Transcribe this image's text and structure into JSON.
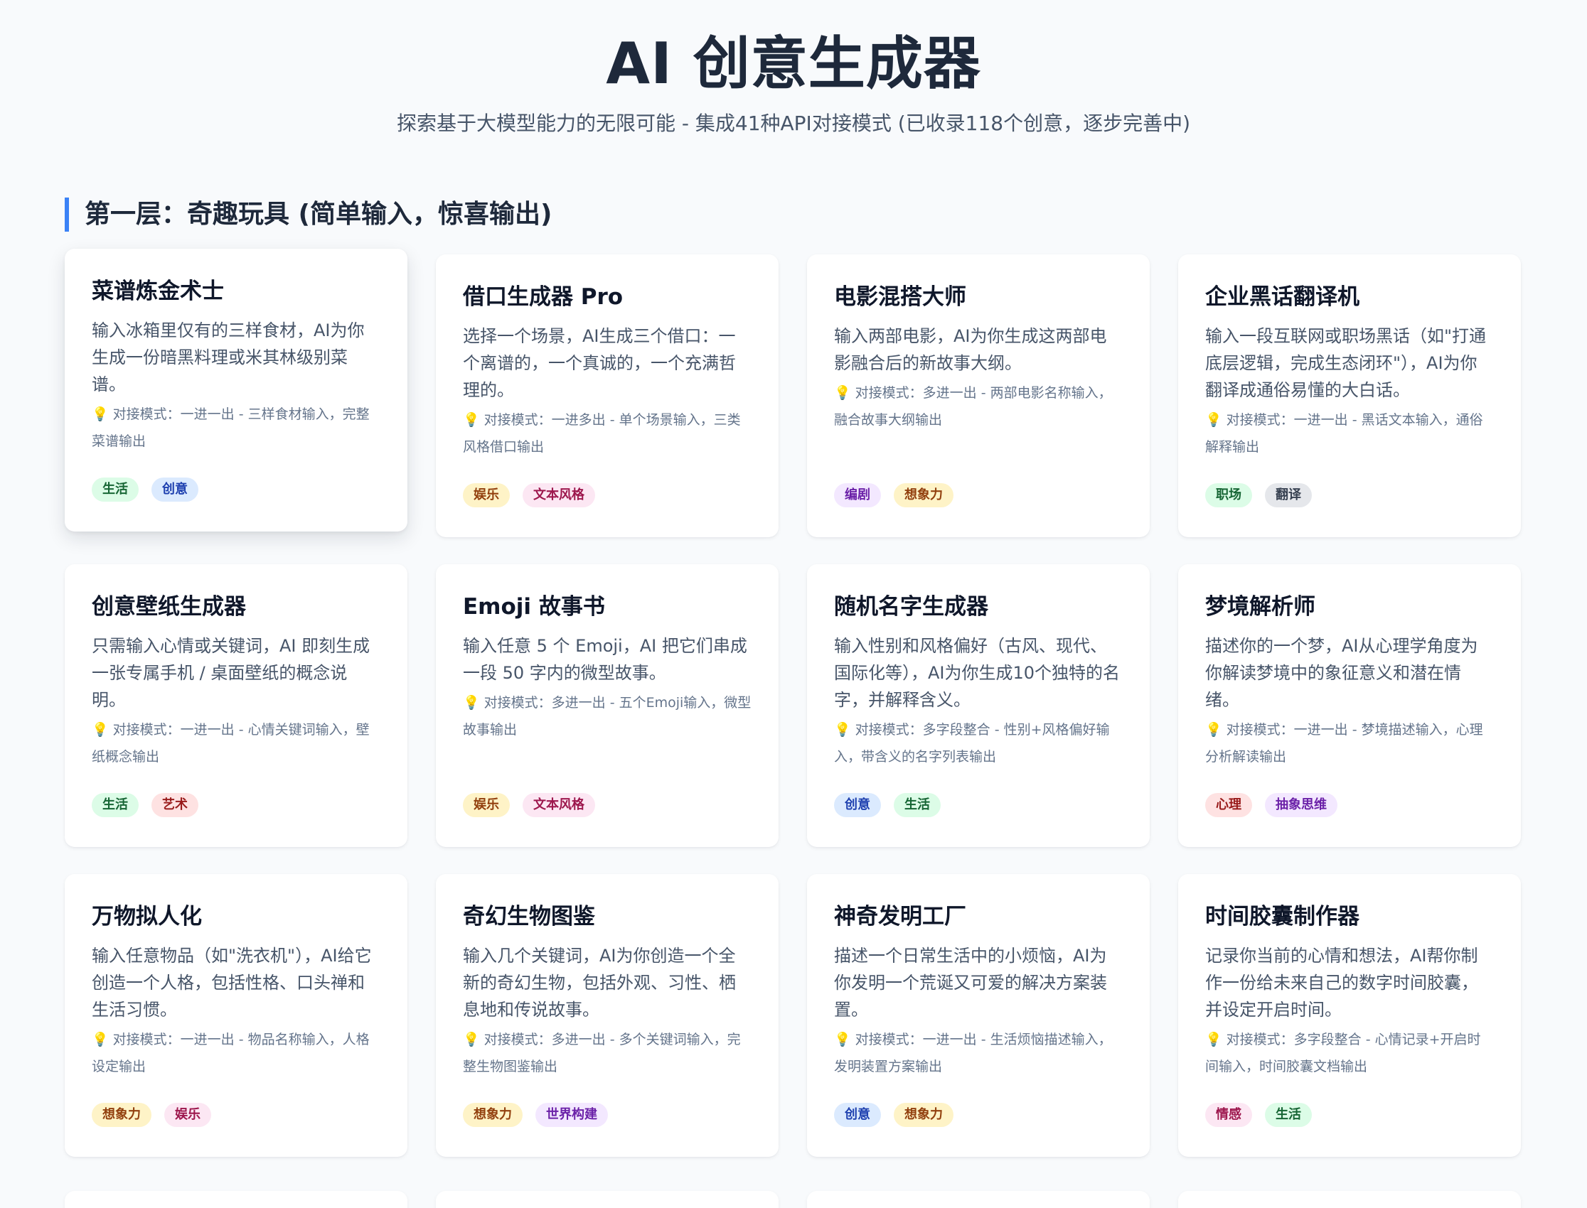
{
  "header": {
    "title": "AI 创意生成器",
    "subtitle": "探索基于大模型能力的无限可能 - 集成41种API对接模式 (已收录118个创意，逐步完善中)"
  },
  "section": {
    "title": "第一层：奇趣玩具 (简单输入，惊喜输出)"
  },
  "colors": {
    "accent": "#3b82f6",
    "green": "#dcfce7",
    "blue": "#dbeafe",
    "amber": "#fef3c7",
    "pink": "#fce7f3",
    "purple": "#f3e8ff",
    "gray": "#e5e7eb",
    "red": "#fee2e2"
  },
  "cards": [
    {
      "title": "菜谱炼金术士",
      "desc": "输入冰箱里仅有的三样食材，AI为你生成一份暗黑料理或米其林级别菜谱。",
      "mode": "对接模式：一进一出 - 三样食材输入，完整菜谱输出",
      "tags": [
        {
          "label": "生活",
          "color": "green"
        },
        {
          "label": "创意",
          "color": "blue"
        }
      ]
    },
    {
      "title": "借口生成器 Pro",
      "desc": "选择一个场景，AI生成三个借口：一个离谱的，一个真诚的，一个充满哲理的。",
      "mode": "对接模式：一进多出 - 单个场景输入，三类风格借口输出",
      "tags": [
        {
          "label": "娱乐",
          "color": "amber"
        },
        {
          "label": "文本风格",
          "color": "pink"
        }
      ]
    },
    {
      "title": "电影混搭大师",
      "desc": "输入两部电影，AI为你生成这两部电影融合后的新故事大纲。",
      "mode": "对接模式：多进一出 - 两部电影名称输入，融合故事大纲输出",
      "tags": [
        {
          "label": "编剧",
          "color": "purple"
        },
        {
          "label": "想象力",
          "color": "amber"
        }
      ]
    },
    {
      "title": "企业黑话翻译机",
      "desc": "输入一段互联网或职场黑话（如\"打通底层逻辑，完成生态闭环\"），AI为你翻译成通俗易懂的大白话。",
      "mode": "对接模式：一进一出 - 黑话文本输入，通俗解释输出",
      "tags": [
        {
          "label": "职场",
          "color": "green"
        },
        {
          "label": "翻译",
          "color": "gray"
        }
      ]
    },
    {
      "title": "创意壁纸生成器",
      "desc": "只需输入心情或关键词，AI 即刻生成一张专属手机 / 桌面壁纸的概念说明。",
      "mode": "对接模式：一进一出 - 心情关键词输入，壁纸概念输出",
      "tags": [
        {
          "label": "生活",
          "color": "green"
        },
        {
          "label": "艺术",
          "color": "red"
        }
      ]
    },
    {
      "title": "Emoji 故事书",
      "desc": "输入任意 5 个 Emoji，AI 把它们串成一段 50 字内的微型故事。",
      "mode": "对接模式：多进一出 - 五个Emoji输入，微型故事输出",
      "tags": [
        {
          "label": "娱乐",
          "color": "amber"
        },
        {
          "label": "文本风格",
          "color": "pink"
        }
      ]
    },
    {
      "title": "随机名字生成器",
      "desc": "输入性别和风格偏好（古风、现代、国际化等），AI为你生成10个独特的名字，并解释含义。",
      "mode": "对接模式：多字段整合 - 性别+风格偏好输入，带含义的名字列表输出",
      "tags": [
        {
          "label": "创意",
          "color": "blue"
        },
        {
          "label": "生活",
          "color": "green"
        }
      ]
    },
    {
      "title": "梦境解析师",
      "desc": "描述你的一个梦，AI从心理学角度为你解读梦境中的象征意义和潜在情绪。",
      "mode": "对接模式：一进一出 - 梦境描述输入，心理分析解读输出",
      "tags": [
        {
          "label": "心理",
          "color": "red"
        },
        {
          "label": "抽象思维",
          "color": "purple"
        }
      ]
    },
    {
      "title": "万物拟人化",
      "desc": "输入任意物品（如\"洗衣机\"），AI给它创造一个人格，包括性格、口头禅和生活习惯。",
      "mode": "对接模式：一进一出 - 物品名称输入，人格设定输出",
      "tags": [
        {
          "label": "想象力",
          "color": "amber"
        },
        {
          "label": "娱乐",
          "color": "pink"
        }
      ]
    },
    {
      "title": "奇幻生物图鉴",
      "desc": "输入几个关键词，AI为你创造一个全新的奇幻生物，包括外观、习性、栖息地和传说故事。",
      "mode": "对接模式：多进一出 - 多个关键词输入，完整生物图鉴输出",
      "tags": [
        {
          "label": "想象力",
          "color": "amber"
        },
        {
          "label": "世界构建",
          "color": "purple"
        }
      ]
    },
    {
      "title": "神奇发明工厂",
      "desc": "描述一个日常生活中的小烦恼，AI为你发明一个荒诞又可爱的解决方案装置。",
      "mode": "对接模式：一进一出 - 生活烦恼描述输入，发明装置方案输出",
      "tags": [
        {
          "label": "创意",
          "color": "blue"
        },
        {
          "label": "想象力",
          "color": "amber"
        }
      ]
    },
    {
      "title": "时间胶囊制作器",
      "desc": "记录你当前的心情和想法，AI帮你制作一份给未来自己的数字时间胶囊，并设定开启时间。",
      "mode": "对接模式：多字段整合 - 心情记录+开启时间输入，时间胶囊文档输出",
      "tags": [
        {
          "label": "情感",
          "color": "pink"
        },
        {
          "label": "生活",
          "color": "green"
        }
      ]
    }
  ]
}
